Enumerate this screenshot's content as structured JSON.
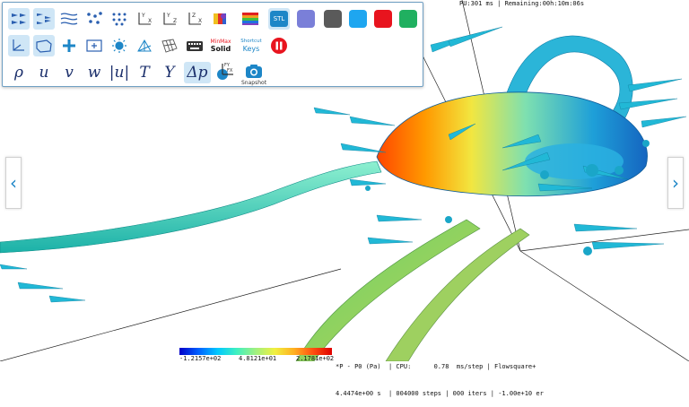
{
  "status_top": "PU:301 ms | Remaining:00h:10m:06s",
  "toolbar": {
    "min_max_label_top": "MinMax",
    "min_max_label_bottom": "Solid",
    "shortcut_top": "Shortcut",
    "shortcut_bottom": "Keys",
    "stl_label": "STL",
    "snapshot_label": "Snapshot",
    "vars": [
      "ρ",
      "u",
      "v",
      "w",
      "|u|",
      "T",
      "Y",
      "Δp"
    ],
    "swatch_colors": [
      "#7a7fd8",
      "#5a5a5a",
      "#1ea6f0",
      "#e8141e",
      "#20b060"
    ]
  },
  "nav": {
    "left": "‹",
    "right": "›"
  },
  "legend": {
    "min_label": "-1.2157e+02",
    "mid_label": "4.8121e+01",
    "max_label": "2.1781e+02"
  },
  "sim_info": {
    "line1": "*P - P0 (Pa)  | CPU:      0.78  ms/step | Flowsquare+",
    "line2": "4.4474e+00 s  | 004000 steps | 000 iters | -1.00e+10 er"
  },
  "colors": {
    "accent": "#1d86c7",
    "cone": "#21b8d6",
    "hull_hot": "#ff6a00"
  }
}
